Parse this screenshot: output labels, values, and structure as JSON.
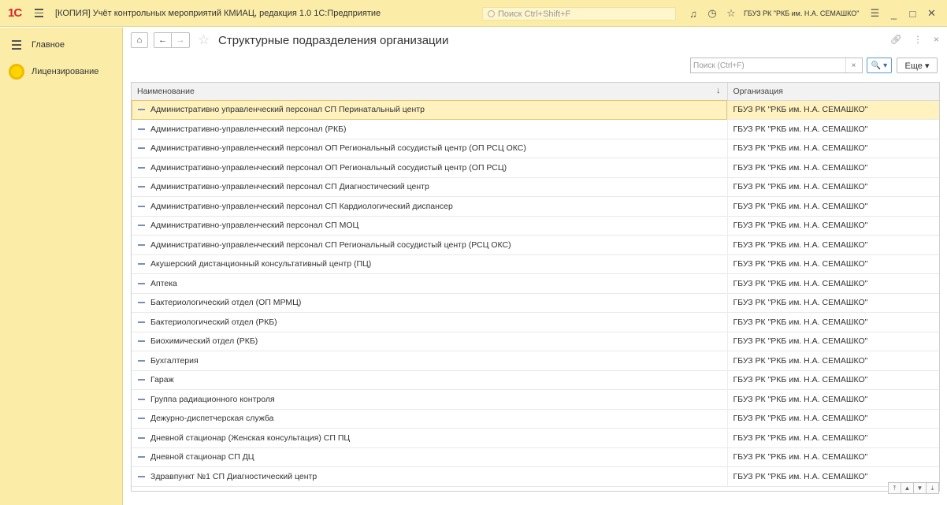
{
  "titlebar": {
    "logo": "1С",
    "app_title": "[КОПИЯ] Учёт контрольных мероприятий КМИАЦ, редакция 1.0 1С:Предприятие",
    "search_placeholder": "Поиск Ctrl+Shift+F",
    "org": "ГБУЗ РК \"РКБ им. Н.А. СЕМАШКО\""
  },
  "sidebar": {
    "items": [
      {
        "label": "Главное",
        "icon": "hamburger-icon"
      },
      {
        "label": "Лицензирование",
        "icon": "yellow-circle-icon"
      }
    ]
  },
  "form": {
    "title": "Структурные подразделения организации",
    "search_placeholder": "Поиск (Ctrl+F)",
    "more_label": "Еще ▾",
    "search_button_label": "🔍 ▾"
  },
  "table": {
    "columns": [
      "Наименование",
      "Организация"
    ],
    "rows": [
      [
        "Административно управленческий персонал СП Перинатальный центр",
        "ГБУЗ РК \"РКБ им. Н.А. СЕМАШКО\""
      ],
      [
        "Административно-управленческий персонал (РКБ)",
        "ГБУЗ РК \"РКБ им. Н.А. СЕМАШКО\""
      ],
      [
        "Административно-управленческий персонал ОП Региональный сосудистый центр (ОП РСЦ ОКС)",
        "ГБУЗ РК \"РКБ им. Н.А. СЕМАШКО\""
      ],
      [
        "Административно-управленческий персонал ОП Региональный сосудистый центр (ОП РСЦ)",
        "ГБУЗ РК \"РКБ им. Н.А. СЕМАШКО\""
      ],
      [
        "Административно-управленческий персонал СП Диагностический центр",
        "ГБУЗ РК \"РКБ им. Н.А. СЕМАШКО\""
      ],
      [
        "Административно-управленческий персонал СП Кардиологический диспансер",
        "ГБУЗ РК \"РКБ им. Н.А. СЕМАШКО\""
      ],
      [
        "Административно-управленческий персонал СП МОЦ",
        "ГБУЗ РК \"РКБ им. Н.А. СЕМАШКО\""
      ],
      [
        "Административно-управленческий персонал СП Региональный сосудистый центр (РСЦ ОКС)",
        "ГБУЗ РК \"РКБ им. Н.А. СЕМАШКО\""
      ],
      [
        "Акушерский дистанционный консультативный центр (ПЦ)",
        "ГБУЗ РК \"РКБ им. Н.А. СЕМАШКО\""
      ],
      [
        "Аптека",
        "ГБУЗ РК \"РКБ им. Н.А. СЕМАШКО\""
      ],
      [
        "Бактериологический отдел (ОП МРМЦ)",
        "ГБУЗ РК \"РКБ им. Н.А. СЕМАШКО\""
      ],
      [
        "Бактериологический отдел (РКБ)",
        "ГБУЗ РК \"РКБ им. Н.А. СЕМАШКО\""
      ],
      [
        "Биохимический отдел (РКБ)",
        "ГБУЗ РК \"РКБ им. Н.А. СЕМАШКО\""
      ],
      [
        "Бухгалтерия",
        "ГБУЗ РК \"РКБ им. Н.А. СЕМАШКО\""
      ],
      [
        "Гараж",
        "ГБУЗ РК \"РКБ им. Н.А. СЕМАШКО\""
      ],
      [
        "Группа радиационного контроля",
        "ГБУЗ РК \"РКБ им. Н.А. СЕМАШКО\""
      ],
      [
        "Дежурно-диспетчерская служба",
        "ГБУЗ РК \"РКБ им. Н.А. СЕМАШКО\""
      ],
      [
        "Дневной стационар (Женская консультация) СП ПЦ",
        "ГБУЗ РК \"РКБ им. Н.А. СЕМАШКО\""
      ],
      [
        "Дневной стационар СП ДЦ",
        "ГБУЗ РК \"РКБ им. Н.А. СЕМАШКО\""
      ],
      [
        "Здравпункт №1 СП Диагностический центр",
        "ГБУЗ РК \"РКБ им. Н.А. СЕМАШКО\""
      ]
    ],
    "selected_row": 0
  },
  "colors": {
    "panel": "#fbeda8",
    "selected_row": "#fff2bf",
    "logo_red": "#d9252a"
  }
}
